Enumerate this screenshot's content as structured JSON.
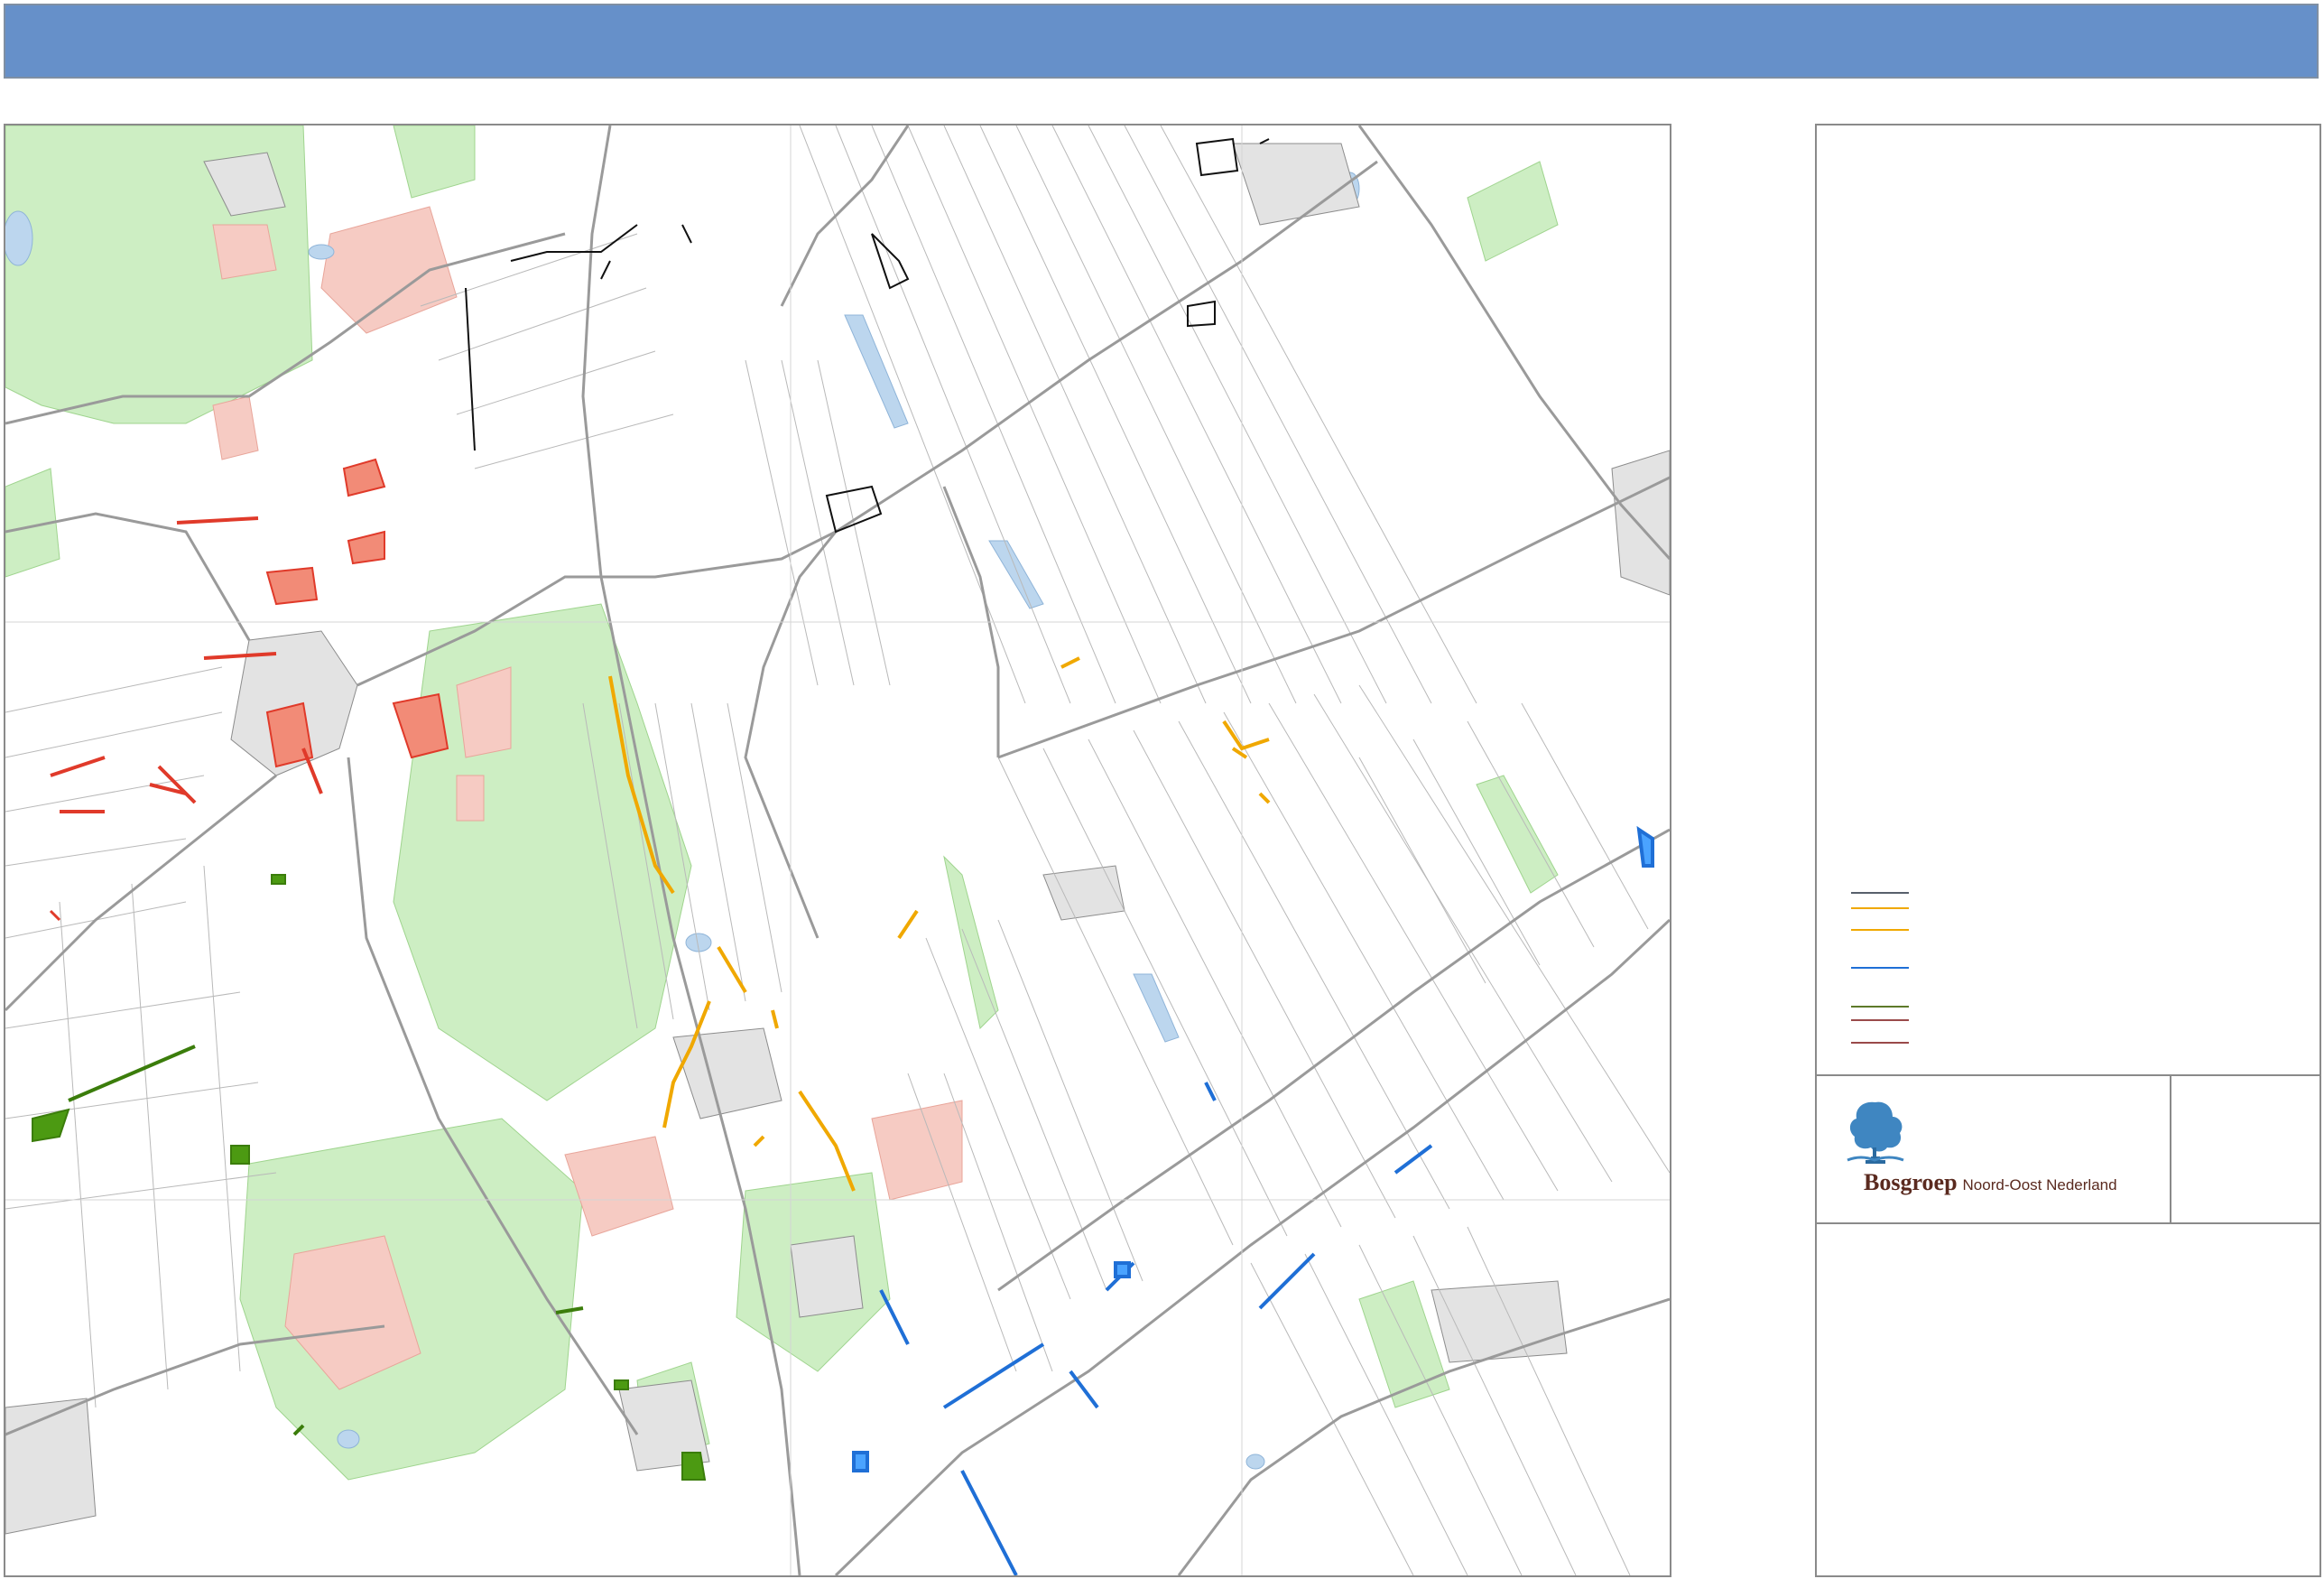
{
  "header": {
    "title": ""
  },
  "legend": {
    "lines": [
      {
        "color": "#58606b"
      },
      {
        "color": "#f0a800"
      },
      {
        "color": "#f0a800"
      },
      {
        "color": "#1f6fd6"
      },
      {
        "color": "#5d7a2a"
      },
      {
        "color": "#9a4a4a"
      },
      {
        "color": "#9a4a4a"
      }
    ]
  },
  "logo": {
    "brand": "Bosgroep",
    "subtitle": "Noord-Oost Nederland",
    "icon": "tree-icon"
  },
  "map": {
    "colors": {
      "forest": "#cdeec3",
      "heath": "#f6cbc3",
      "water": "#bcd6ee",
      "road": "#9a9a9a",
      "red_measure": "#e03a2a",
      "orange_measure": "#f0a800",
      "blue_measure": "#1f6fd6",
      "green_measure": "#4c9a12",
      "black_measure": "#111111"
    }
  }
}
